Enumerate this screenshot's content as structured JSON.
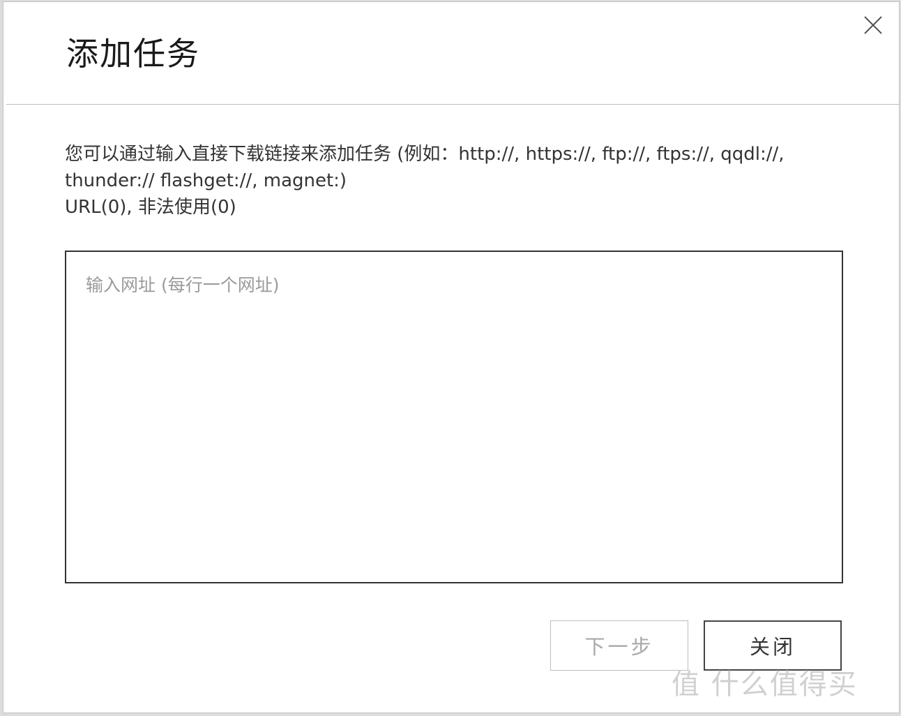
{
  "dialog": {
    "title": "添加任务",
    "close_icon": "close-icon",
    "description_lines": [
      "您可以通过输入直接下载链接来添加任务 (例如：http://, https://, ftp://, ftps://, qqdl://,",
      "thunder:// flashget://, magnet:)",
      "URL(0), 非法使用(0)"
    ],
    "url_input": {
      "placeholder": "输入网址 (每行一个网址)",
      "value": ""
    },
    "buttons": {
      "next_label": "下一步",
      "close_label": "关闭"
    }
  },
  "watermark": "值 什么值得买",
  "colors": {
    "text": "#333333",
    "disabled_text": "#a8a8a8",
    "border": "#333333",
    "divider": "#bdbdbd"
  }
}
